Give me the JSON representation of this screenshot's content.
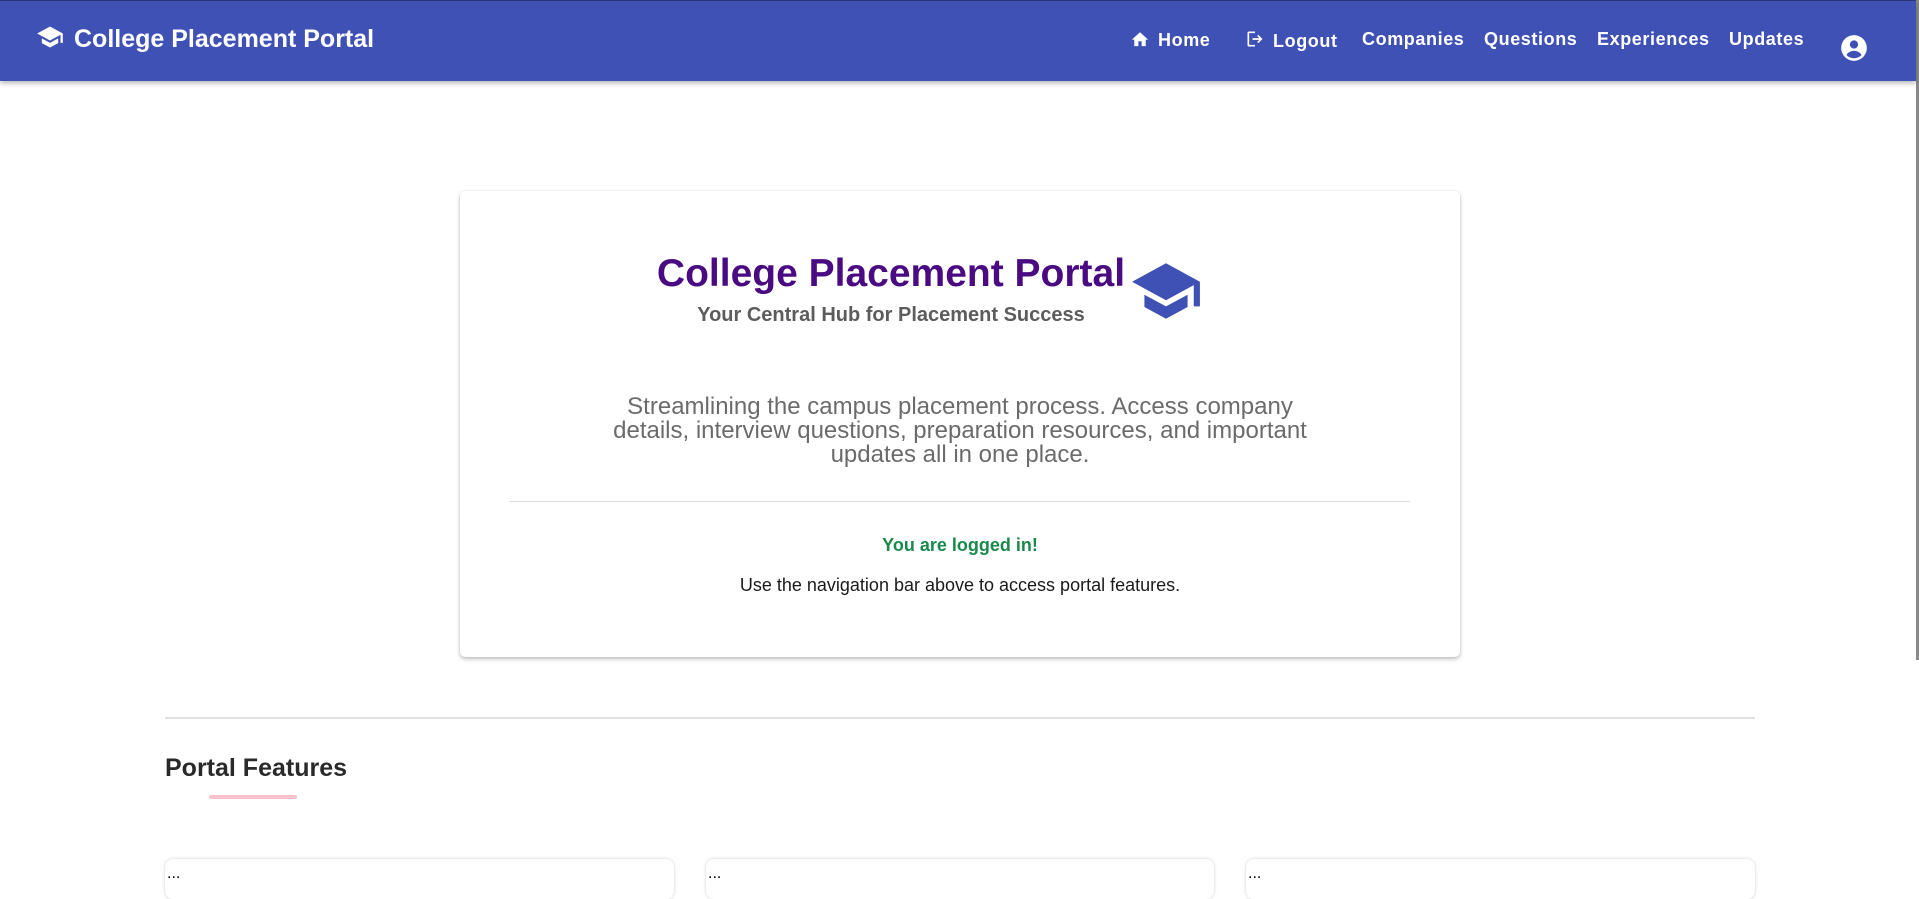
{
  "header": {
    "brand": "College Placement Portal",
    "nav": [
      {
        "label": "Home",
        "icon": "home-icon"
      },
      {
        "label": "Logout",
        "icon": "logout-icon"
      },
      {
        "label": "Companies"
      },
      {
        "label": "Questions"
      },
      {
        "label": "Experiences"
      },
      {
        "label": "Updates"
      }
    ],
    "account_icon": "account-circle-icon"
  },
  "hero": {
    "title": "College Placement Portal",
    "subtitle": "Your Central Hub for Placement Success",
    "description": "Streamlining the campus placement process. Access company details, interview questions, preparation resources, and important updates all in one place.",
    "status": "You are logged in!",
    "hint": "Use the navigation bar above to access portal features."
  },
  "features": {
    "title": "Portal Features",
    "cards": [
      {
        "text": "..."
      },
      {
        "text": "..."
      },
      {
        "text": "..."
      }
    ]
  },
  "colors": {
    "primary": "#3f51b5",
    "title": "#4a0a82",
    "success": "#1a8a4c",
    "accent": "#f8c2cc"
  }
}
